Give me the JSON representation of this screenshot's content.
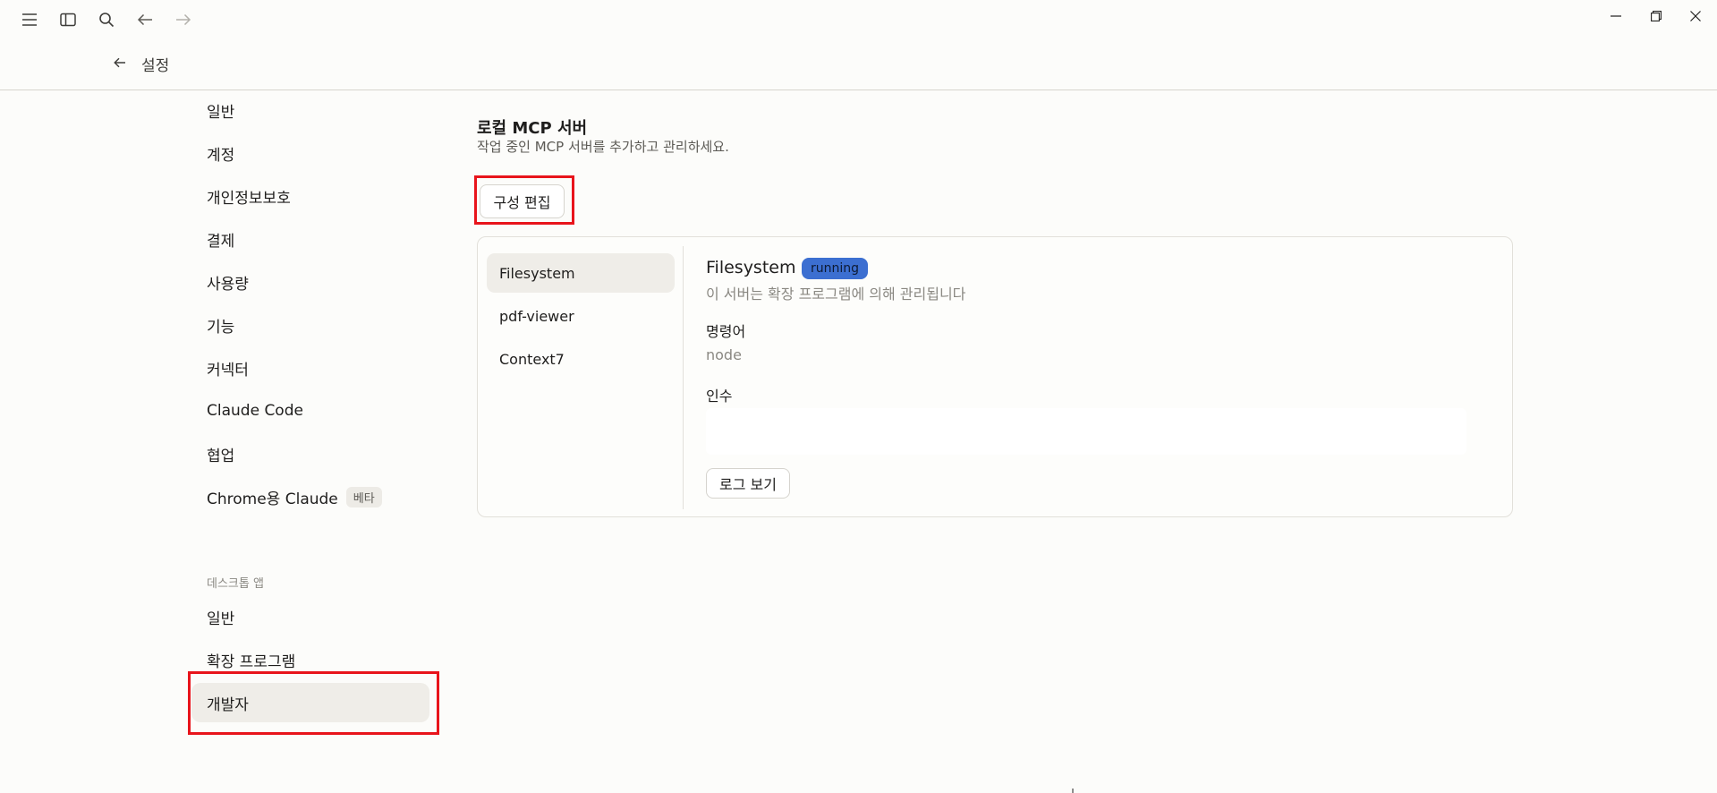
{
  "header": {
    "title": "설정"
  },
  "sidebar": {
    "items": [
      {
        "label": "일반"
      },
      {
        "label": "계정"
      },
      {
        "label": "개인정보보호"
      },
      {
        "label": "결제"
      },
      {
        "label": "사용량"
      },
      {
        "label": "기능"
      },
      {
        "label": "커넥터"
      },
      {
        "label": "Claude Code"
      },
      {
        "label": "협업"
      },
      {
        "label": "Chrome용 Claude",
        "badge": "베타"
      }
    ],
    "desktop_section_label": "데스크톱 앱",
    "desktop_items": [
      {
        "label": "일반"
      },
      {
        "label": "확장 프로그램"
      },
      {
        "label": "개발자",
        "active": true
      }
    ]
  },
  "main": {
    "title": "로컬 MCP 서버",
    "subtitle": "작업 중인 MCP 서버를 추가하고 관리하세요.",
    "edit_config_label": "구성 편집",
    "servers": [
      {
        "name": "Filesystem",
        "active": true
      },
      {
        "name": "pdf-viewer"
      },
      {
        "name": "Context7"
      }
    ],
    "detail": {
      "name": "Filesystem",
      "status": "running",
      "description": "이 서버는 확장 프로그램에 의해 관리됩니다",
      "command_label": "명령어",
      "command_value": "node",
      "args_label": "인수",
      "args_value": "",
      "view_logs_label": "로그 보기"
    }
  },
  "colors": {
    "highlight": "#e8141b",
    "status_running": "#3c6fd1",
    "active_bg": "#efede8"
  }
}
